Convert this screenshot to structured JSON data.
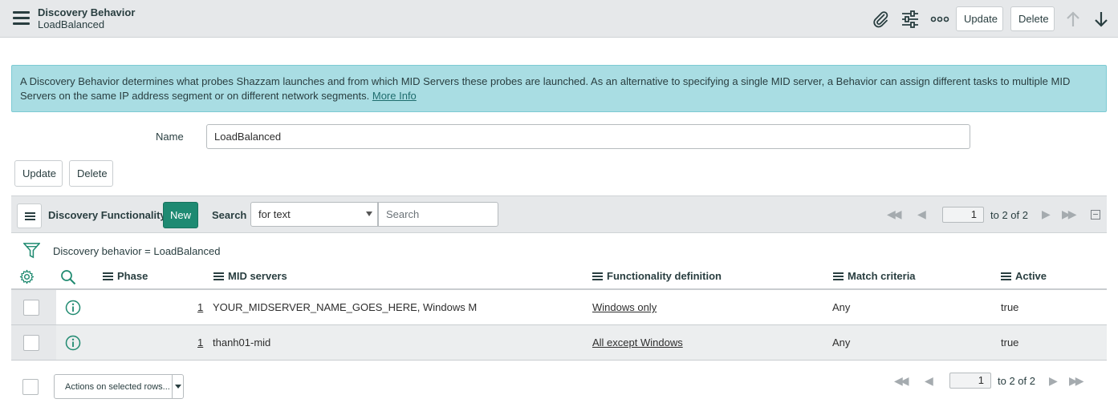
{
  "header": {
    "title": "Discovery Behavior",
    "subtitle": "LoadBalanced",
    "update_label": "Update",
    "delete_label": "Delete"
  },
  "banner": {
    "text": "A Discovery Behavior determines what probes Shazzam launches and from which MID Servers these probes are launched. As an alternative to specifying a single MID server, a Behavior can assign different tasks to multiple MID Servers on the same IP address segment or on different network segments.",
    "link": "More Info"
  },
  "form": {
    "name_label": "Name",
    "name_value": "LoadBalanced",
    "update_label": "Update",
    "delete_label": "Delete"
  },
  "list": {
    "title": "Discovery Functionality",
    "new_label": "New",
    "search_label": "Search",
    "search_select": "for text",
    "search_placeholder": "Search",
    "page": "1",
    "page_of": "to 2 of 2",
    "filter": "Discovery behavior = LoadBalanced",
    "columns": [
      "Phase",
      "MID servers",
      "Functionality definition",
      "Match criteria",
      "Active"
    ],
    "rows": [
      {
        "phase": "1",
        "mid_servers": "YOUR_MIDSERVER_NAME_GOES_HERE, Windows M",
        "definition": "Windows only",
        "match": "Any",
        "active": "true"
      },
      {
        "phase": "1",
        "mid_servers": "thanh01-mid",
        "definition": "All except Windows",
        "match": "Any",
        "active": "true"
      }
    ]
  },
  "footer": {
    "actions_label": "Actions on selected rows...",
    "page": "1",
    "page_of": "to 2 of 2"
  },
  "colors": {
    "header_bg": "#e6e8ea",
    "banner_bg": "#a9dde3",
    "new_button": "#1e8a72",
    "icon_teal": "#1f8a70"
  },
  "icons": [
    "menu-icon",
    "paperclip-icon",
    "sliders-icon",
    "more-icon",
    "arrow-up-icon",
    "arrow-down-icon",
    "filter-icon",
    "gear-icon",
    "search-icon",
    "info-icon"
  ]
}
